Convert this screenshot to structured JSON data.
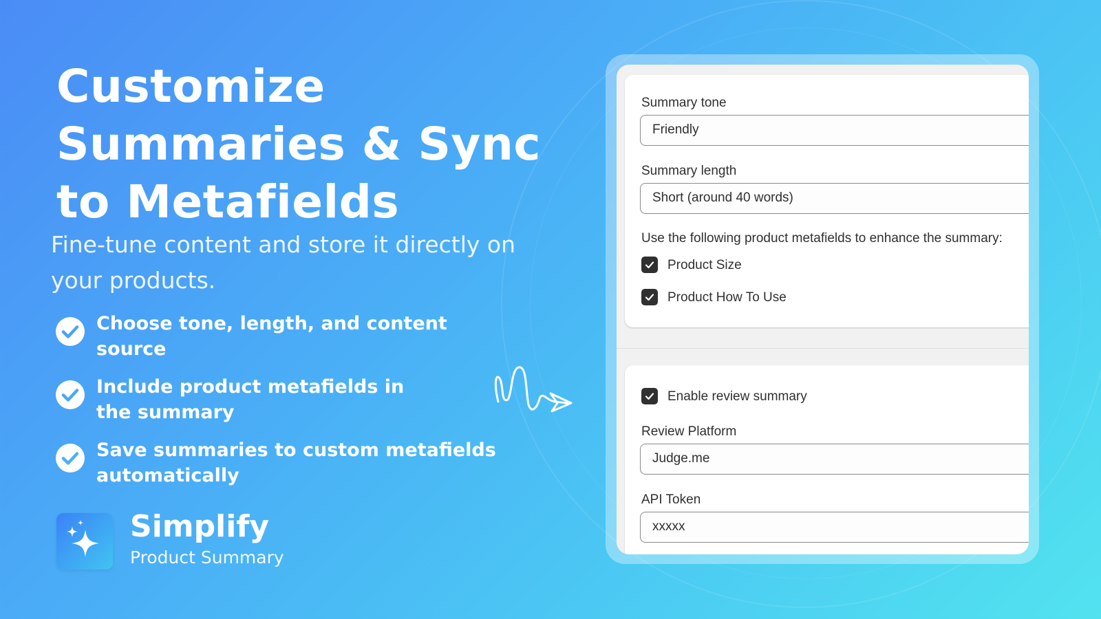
{
  "headline": {
    "line1": "Customize",
    "line2": "Summaries & Sync",
    "line3": "to Metafields"
  },
  "subhead": {
    "line1": "Fine-tune content and store it directly on",
    "line2": "your products."
  },
  "features": [
    {
      "line1": "Choose tone, length, and content",
      "line2": "source"
    },
    {
      "line1": "Include product metafields in",
      "line2": "the summary"
    },
    {
      "line1": "Save summaries to custom metafields",
      "line2": "automatically"
    }
  ],
  "brand": {
    "name": "Simplify",
    "tagline": "Product Summary"
  },
  "settings": {
    "summary_tone": {
      "label": "Summary tone",
      "value": "Friendly"
    },
    "summary_length": {
      "label": "Summary length",
      "value": "Short (around 40 words)"
    },
    "metafields_prompt": "Use the following product metafields to enhance the summary:",
    "metafields": [
      {
        "label": "Product Size",
        "checked": true
      },
      {
        "label": "Product How To Use",
        "checked": true
      }
    ],
    "review": {
      "enable_label": "Enable review summary",
      "enabled": true,
      "platform_label": "Review Platform",
      "platform_value": "Judge.me",
      "token_label": "API Token",
      "token_value": "xxxxx"
    }
  },
  "icons": {
    "feature_check": "check-circle-icon",
    "logo": "sparkles-icon",
    "arrow": "squiggle-arrow-icon",
    "checkbox": "checkmark-icon"
  },
  "colors": {
    "gradient_start": "#4a8cf6",
    "gradient_end": "#52e3ef",
    "checkbox_fill": "#303030",
    "text_dark": "#303030"
  }
}
